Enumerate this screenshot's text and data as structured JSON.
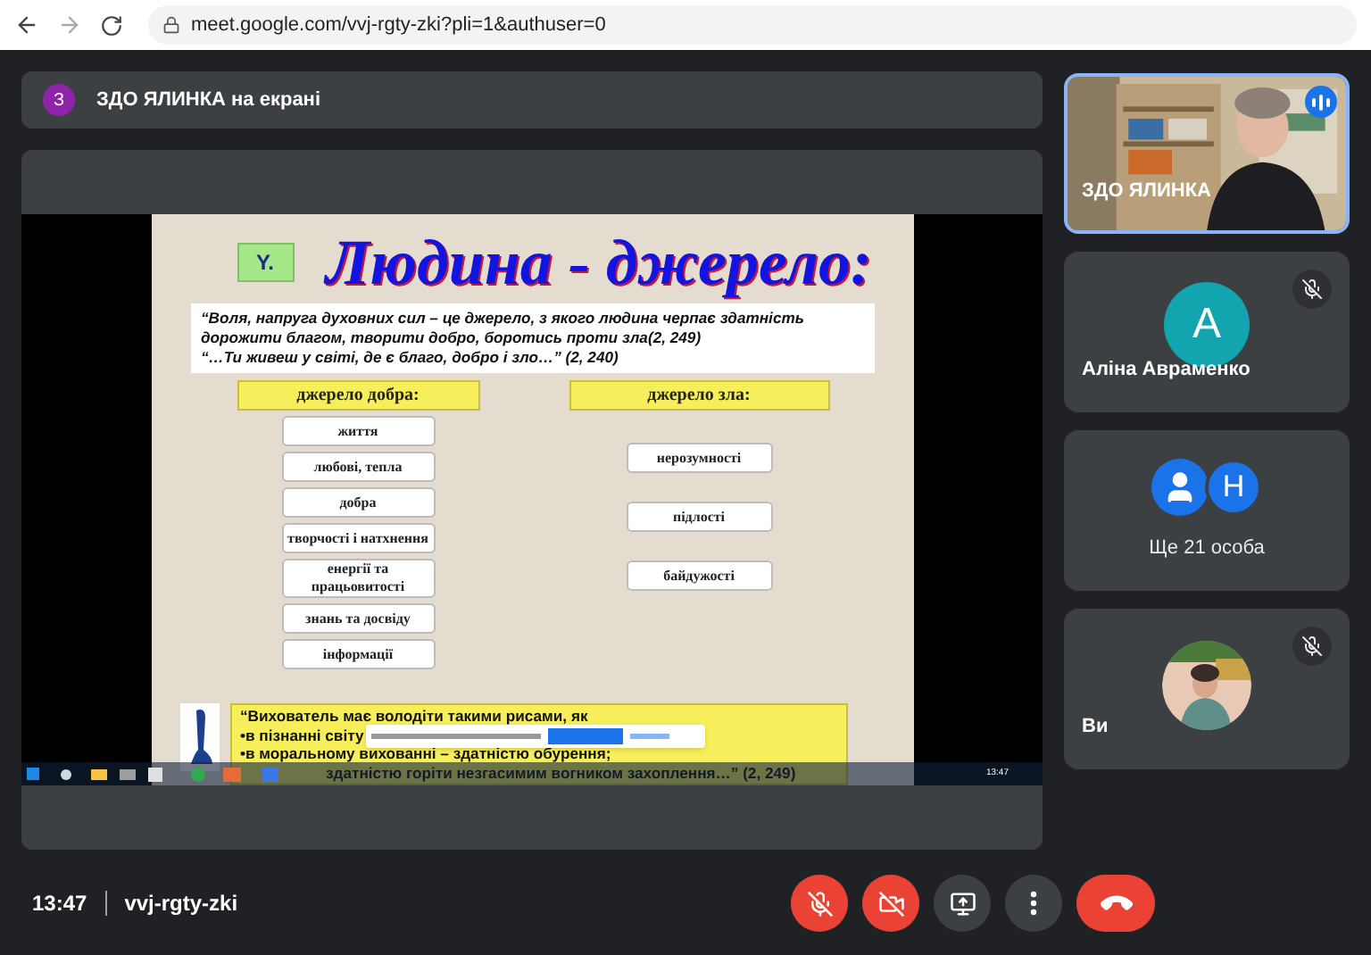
{
  "browser": {
    "url": "meet.google.com/vvj-rgty-zki?pli=1&authuser=0"
  },
  "presenting_banner": {
    "avatar_letter": "З",
    "text": "ЗДО ЯЛИНКА на екрані"
  },
  "shared_slide": {
    "badge": "Y.",
    "title": "Людина - джерело:",
    "quote_lines": [
      "“Воля, напруга духовних сил – це джерело, з якого людина черпає здатність дорожити благом, творити добро, боротись проти зла(2, 249)",
      "“…Ти живеш у світі, де є благо, добро і зло…” (2, 240)"
    ],
    "columns": [
      {
        "header": "джерело добра:",
        "items": [
          "життя",
          "любові, тепла",
          "добра",
          "творчості і натхнення",
          "енергії та працьовитості",
          "знань та досвіду",
          "інформації"
        ]
      },
      {
        "header": "джерело зла:",
        "items": [
          "нерозумності",
          "підлості",
          "байдужості"
        ]
      }
    ],
    "bottom_lines": [
      "“Вихователь має володіти такими рисами, як",
      "•в пізнанні світу",
      "•в моральному вихованні – здатністю обурення;",
      "здатністю горіти незгасимим вогником захоплення…” (2, 249)"
    ],
    "taskbar_clock": "13:47"
  },
  "participants": [
    {
      "kind": "video",
      "name": "ЗДО ЯЛИНКА",
      "speaking": true
    },
    {
      "kind": "avatar",
      "letter": "A",
      "name": "Аліна Авраменко",
      "color": "#12a4af",
      "muted": true,
      "speaking": false
    },
    {
      "kind": "group",
      "letter": "H",
      "label": "Ще 21 особа",
      "color": "#1a73e8"
    },
    {
      "name": "Ви",
      "muted": true,
      "speaking": false
    }
  ],
  "meeting": {
    "time": "13:47",
    "code": "vvj-rgty-zki"
  },
  "controls": [
    {
      "kind": "mic",
      "off": true
    },
    {
      "kind": "camera",
      "off": true
    },
    {
      "kind": "present"
    },
    {
      "kind": "more"
    },
    {
      "kind": "hangup"
    }
  ]
}
